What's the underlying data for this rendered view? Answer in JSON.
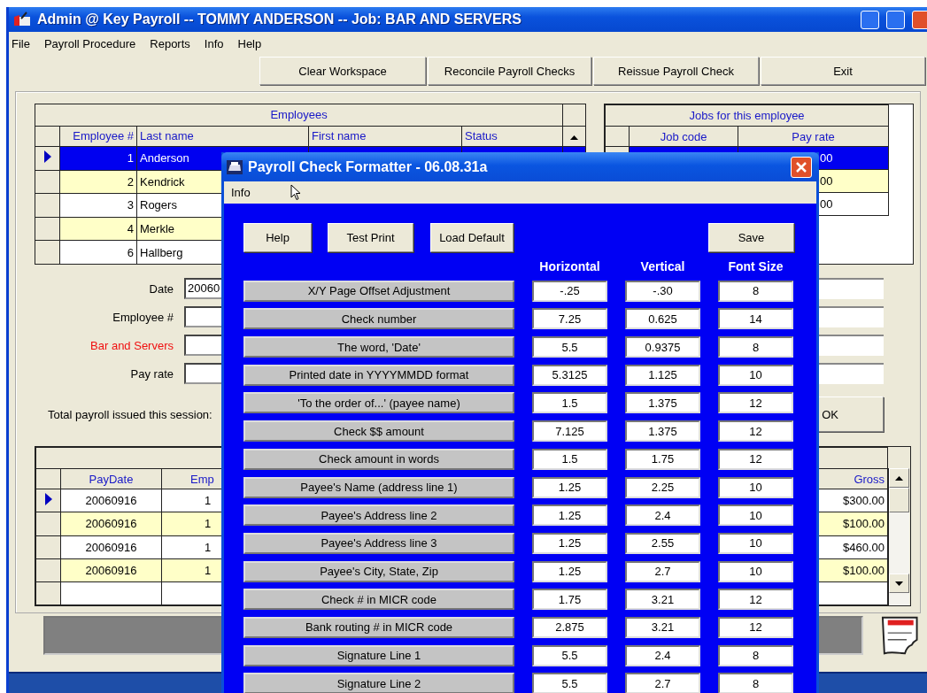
{
  "window": {
    "title": "Admin @ Key Payroll -- TOMMY ANDERSON -- Job: BAR AND SERVERS"
  },
  "menu": [
    "File",
    "Payroll Procedure",
    "Reports",
    "Info",
    "Help"
  ],
  "toolbar": [
    "Clear Workspace",
    "Reconcile Payroll Checks",
    "Reissue Payroll Check",
    "Exit"
  ],
  "employees": {
    "title": "Employees",
    "columns": [
      "Employee #",
      "Last name",
      "First name",
      "Status"
    ],
    "rows": [
      {
        "number": "1",
        "last_name": "Anderson",
        "selected": true
      },
      {
        "number": "2",
        "last_name": "Kendrick",
        "selected": false
      },
      {
        "number": "3",
        "last_name": "Rogers",
        "selected": false
      },
      {
        "number": "4",
        "last_name": "Merkle",
        "selected": false
      },
      {
        "number": "6",
        "last_name": "Hallberg",
        "selected": false
      }
    ]
  },
  "jobs": {
    "title": "Jobs for this employee",
    "columns": [
      "Job code",
      "Pay rate"
    ],
    "rows": [
      {
        "pay_rate": "00",
        "selected": true
      },
      {
        "pay_rate": "00",
        "selected": false
      },
      {
        "pay_rate": "00",
        "selected": false
      }
    ]
  },
  "form": {
    "fields": [
      {
        "label": "Date",
        "value": "20060",
        "emphasis": false
      },
      {
        "label": "Employee #",
        "emphasis": false
      },
      {
        "label": "Bar and Servers",
        "emphasis": true
      },
      {
        "label": "Pay rate",
        "emphasis": false
      }
    ],
    "total_label": "Total payroll issued this session:",
    "ok": "OK"
  },
  "checks": {
    "columns": [
      "PayDate",
      "Emp",
      "Gross"
    ],
    "rows": [
      {
        "pay_date": "20060916",
        "emp": "1",
        "gross": "$300.00",
        "selected": true
      },
      {
        "pay_date": "20060916",
        "emp": "1",
        "gross": "$100.00",
        "selected": false
      },
      {
        "pay_date": "20060916",
        "emp": "1",
        "gross": "$460.00",
        "selected": false
      },
      {
        "pay_date": "20060916",
        "emp": "1",
        "gross": "$100.00",
        "selected": false
      }
    ]
  },
  "dialog": {
    "title": "Payroll Check Formatter - 06.08.31a",
    "menu": [
      "Info"
    ],
    "buttons": [
      "Help",
      "Test Print",
      "Load Default",
      "Save"
    ],
    "columns": [
      "Horizontal",
      "Vertical",
      "Font Size"
    ],
    "rows": [
      {
        "label": "X/Y Page Offset Adjustment",
        "horizontal": "-.25",
        "vertical": "-.30",
        "font_size": "8"
      },
      {
        "label": "Check number",
        "horizontal": "7.25",
        "vertical": "0.625",
        "font_size": "14"
      },
      {
        "label": "The word, 'Date'",
        "horizontal": "5.5",
        "vertical": "0.9375",
        "font_size": "8"
      },
      {
        "label": "Printed date in YYYYMMDD format",
        "horizontal": "5.3125",
        "vertical": "1.125",
        "font_size": "10"
      },
      {
        "label": "'To the order of...' (payee name)",
        "horizontal": "1.5",
        "vertical": "1.375",
        "font_size": "12"
      },
      {
        "label": "Check $$ amount",
        "horizontal": "7.125",
        "vertical": "1.375",
        "font_size": "12"
      },
      {
        "label": "Check amount in words",
        "horizontal": "1.5",
        "vertical": "1.75",
        "font_size": "12"
      },
      {
        "label": "Payee's Name (address line 1)",
        "horizontal": "1.25",
        "vertical": "2.25",
        "font_size": "10"
      },
      {
        "label": "Payee's Address line 2",
        "horizontal": "1.25",
        "vertical": "2.4",
        "font_size": "10"
      },
      {
        "label": "Payee's Address line 3",
        "horizontal": "1.25",
        "vertical": "2.55",
        "font_size": "10"
      },
      {
        "label": "Payee's City, State, Zip",
        "horizontal": "1.25",
        "vertical": "2.7",
        "font_size": "10"
      },
      {
        "label": "Check # in MICR code",
        "horizontal": "1.75",
        "vertical": "3.21",
        "font_size": "12"
      },
      {
        "label": "Bank routing # in MICR code",
        "horizontal": "2.875",
        "vertical": "3.21",
        "font_size": "12"
      },
      {
        "label": "Signature Line 1",
        "horizontal": "5.5",
        "vertical": "2.4",
        "font_size": "8"
      },
      {
        "label": "Signature Line 2",
        "horizontal": "5.5",
        "vertical": "2.7",
        "font_size": "8"
      }
    ]
  }
}
